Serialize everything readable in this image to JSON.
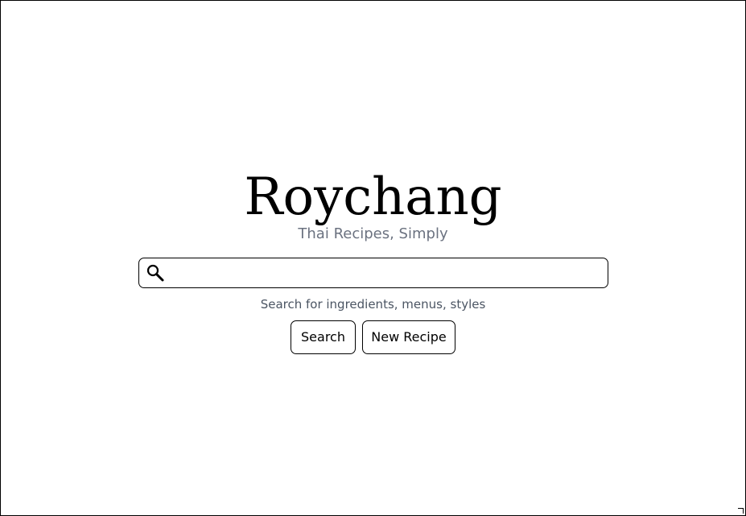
{
  "brand": {
    "title": "Roychang",
    "tagline": "Thai Recipes, Simply"
  },
  "search": {
    "value": "",
    "placeholder": "",
    "hint": "Search for ingredients, menus, styles",
    "icon": "search-icon"
  },
  "actions": {
    "search_label": "Search",
    "new_recipe_label": "New Recipe"
  },
  "colors": {
    "text": "#000000",
    "muted": "#6b7280",
    "hint": "#4b5563",
    "border": "#000000",
    "background": "#ffffff"
  }
}
